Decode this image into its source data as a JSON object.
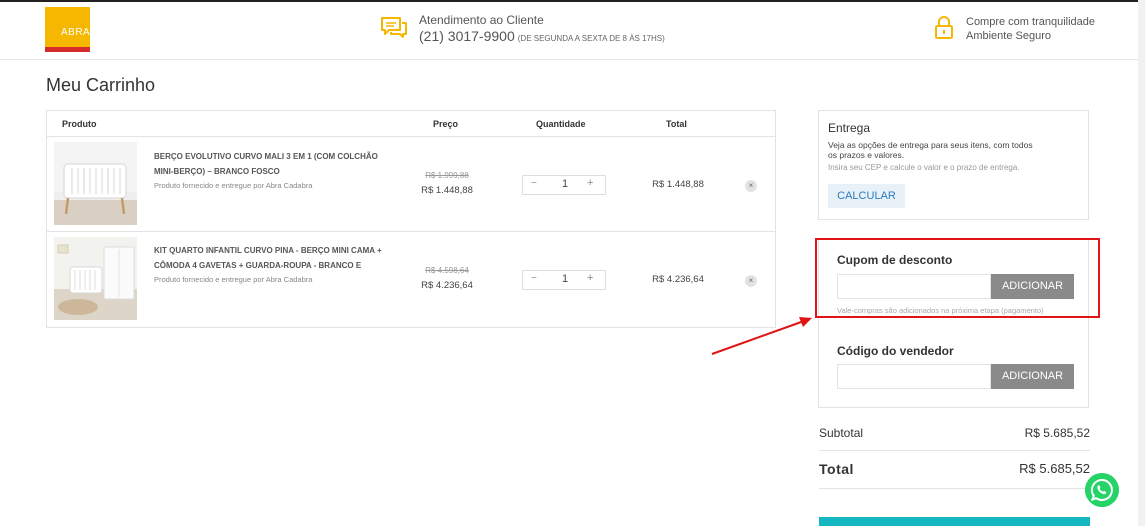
{
  "header": {
    "logo_text": "ABRA",
    "support_title": "Atendimento ao Cliente",
    "support_phone": "(21) 3017-9900",
    "support_hours": "(DE SEGUNDA A SEXTA DE 8 ÀS 17HS)",
    "secure_line1": "Compre com tranquilidade",
    "secure_line2": "Ambiente Seguro"
  },
  "page_title": "Meu Carrinho",
  "table": {
    "headers": {
      "product": "Produto",
      "price": "Preço",
      "quantity": "Quantidade",
      "total": "Total"
    },
    "items": [
      {
        "name": "BERÇO EVOLUTIVO CURVO MALI 3 EM 1 (COM COLCHÃO MINI-BERÇO) – BRANCO FOSCO",
        "seller": "Produto fornecido e entregue por Abra Cadabra",
        "old_price": "R$ 1.999,88",
        "price": "R$ 1.448,88",
        "qty": "1",
        "minus": "−",
        "plus": "+",
        "total": "R$ 1.448,88",
        "remove": "×"
      },
      {
        "name": "KIT QUARTO INFANTIL CURVO PINA - BERÇO MINI CAMA + CÔMODA 4 GAVETAS + GUARDA-ROUPA - BRANCO E",
        "seller": "Produto fornecido e entregue por Abra Cadabra",
        "old_price": "R$ 4.598,64",
        "price": "R$ 4.236,64",
        "qty": "1",
        "minus": "−",
        "plus": "+",
        "total": "R$ 4.236,64",
        "remove": "×"
      }
    ]
  },
  "shipping": {
    "title": "Entrega",
    "description": "Veja as opções de entrega para seus itens, com todos os prazos e valores.",
    "hint": "Insira seu CEP e calcule o valor e o prazo de entrega.",
    "button": "CALCULAR"
  },
  "coupon": {
    "title": "Cupom de desconto",
    "input_value": "",
    "button": "ADICIONAR",
    "note": "Vale-compras são adicionados na próxima etapa (pagamento)"
  },
  "seller_code": {
    "title": "Código do vendedor",
    "input_value": "",
    "button": "ADICIONAR"
  },
  "summary": {
    "subtotal_label": "Subtotal",
    "subtotal_value": "R$ 5.685,52",
    "total_label": "Total",
    "total_value": "R$ 5.685,52"
  },
  "icons": {
    "support": "chat-bubbles-icon",
    "secure": "lock-icon",
    "remove": "close-icon",
    "whatsapp": "whatsapp-icon"
  },
  "colors": {
    "brand_yellow": "#f5b700",
    "brand_red": "#d62b2b",
    "accent_teal": "#15b7c3",
    "calc_blue": "#2b7bbf",
    "button_gray": "#8a8a8a",
    "annotation_red": "#e01414",
    "whatsapp_green": "#25d366"
  }
}
